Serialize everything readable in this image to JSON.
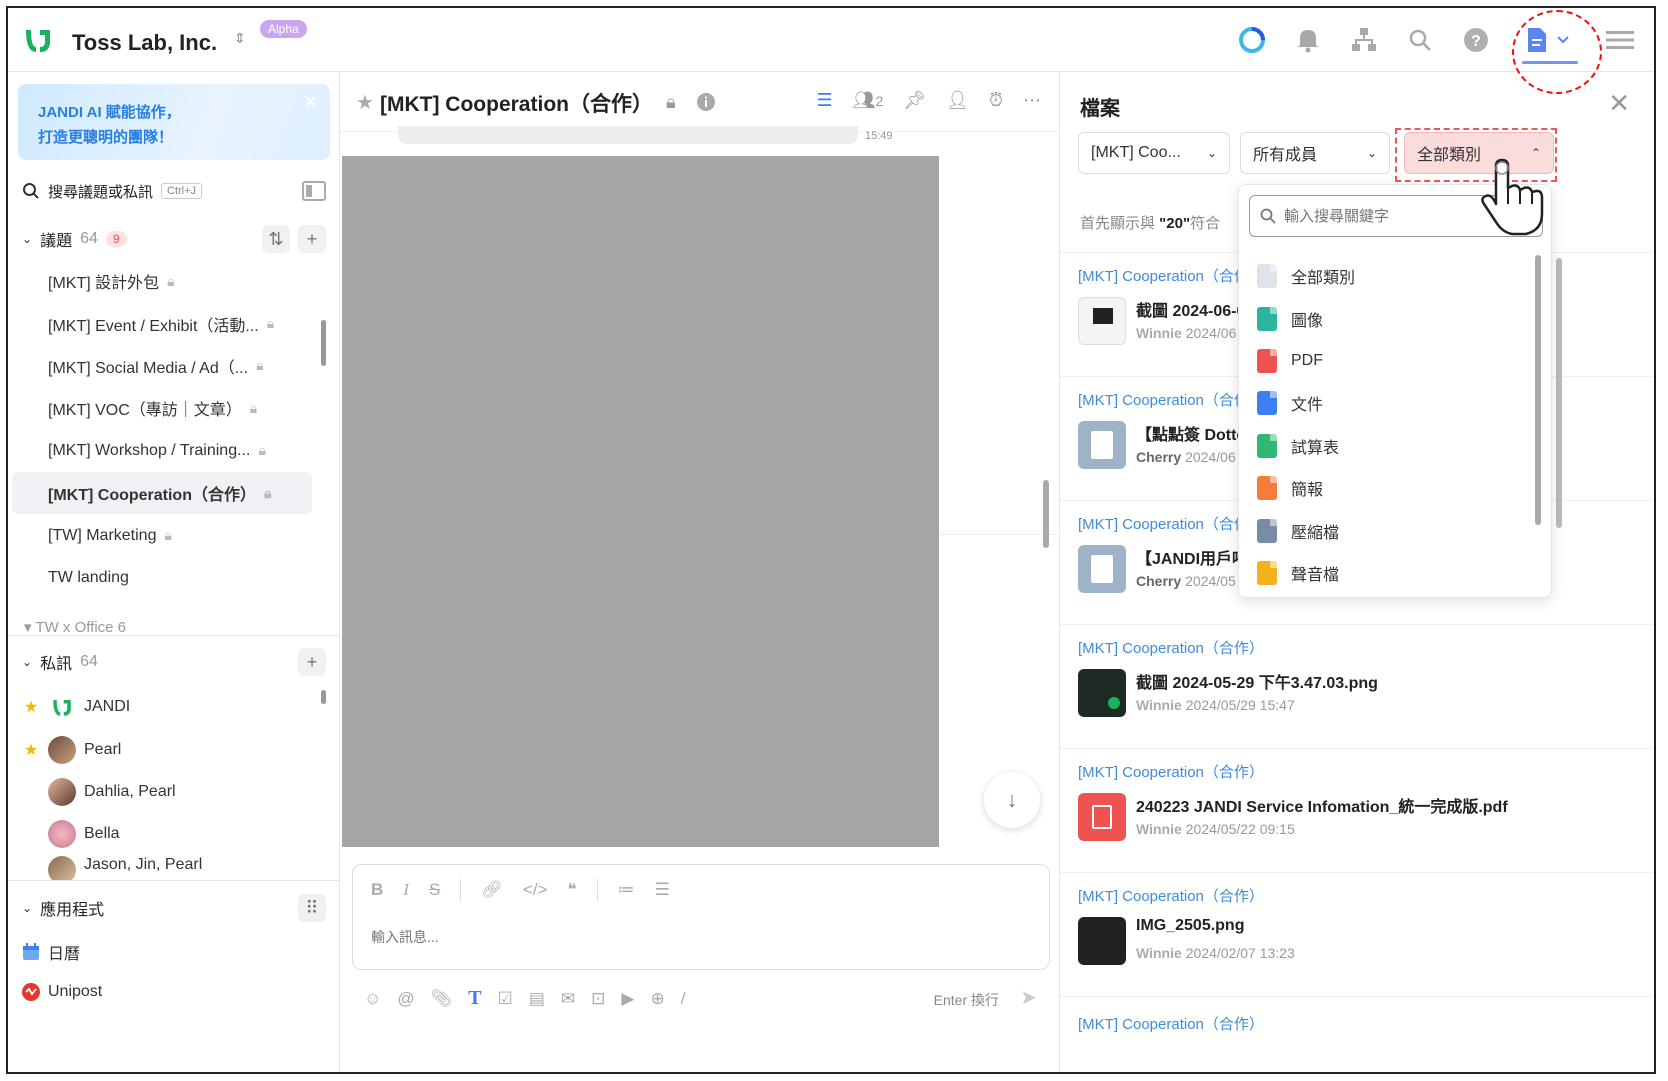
{
  "org": {
    "name": "Toss Lab, Inc.",
    "badge": "Alpha"
  },
  "top_icons": [
    "loading-ring-icon",
    "bell-icon",
    "org-chart-icon",
    "search-icon",
    "help-icon",
    "file-icon",
    "menu-icon"
  ],
  "sidebar": {
    "ai_banner": {
      "line1": "JANDI AI 賦能協作，",
      "line2": "打造更聰明的團隊！"
    },
    "search": {
      "label": "搜尋議題或私訊",
      "shortcut": "Ctrl+J"
    },
    "topics": {
      "title": "議題",
      "count": "64",
      "unread": "9",
      "items": [
        {
          "label": "[MKT] 設計外包"
        },
        {
          "label": "[MKT] Event / Exhibit（活動..."
        },
        {
          "label": "[MKT] Social Media / Ad（..."
        },
        {
          "label": "[MKT] VOC（專訪｜文章）"
        },
        {
          "label": "[MKT] Workshop / Training..."
        },
        {
          "label": "[MKT] Cooperation（合作）"
        },
        {
          "label": "[TW] Marketing"
        },
        {
          "label": "TW landing"
        }
      ],
      "folder": "TW x Office 6"
    },
    "dms": {
      "title": "私訊",
      "count": "64",
      "items": [
        {
          "label": "JANDI"
        },
        {
          "label": "Pearl"
        },
        {
          "label": "Dahlia, Pearl"
        },
        {
          "label": "Bella"
        },
        {
          "label": "Jason, Jin, Pearl"
        }
      ]
    },
    "apps": {
      "title": "應用程式",
      "items": [
        {
          "label": "日曆"
        },
        {
          "label": "Unipost"
        }
      ]
    }
  },
  "chat": {
    "title": "[MKT] Cooperation（合作）",
    "member_count": "2",
    "message_time": "15:49",
    "composer_placeholder": "輸入訊息...",
    "enter_hint": "Enter 換行"
  },
  "files": {
    "title": "檔案",
    "filters": {
      "topic": "[MKT] Coo...",
      "member": "所有成員",
      "category": "全部類別"
    },
    "result_prefix": "首先顯示與 ",
    "result_query": "\"20\"",
    "result_suffix": "符合",
    "cards": [
      {
        "topic": "[MKT] Cooperation（合作）",
        "name": "截圖 2024-06-0",
        "author": "Winnie",
        "date": "2024/06"
      },
      {
        "topic": "[MKT] Cooperation（合作）",
        "name": "【點點簽 Dotte",
        "author": "Cherry",
        "date": "2024/06"
      },
      {
        "topic": "[MKT] Cooperation（合作）",
        "name": "【JANDI用戶呼",
        "author": "Cherry",
        "date": "2024/05"
      },
      {
        "topic": "[MKT] Cooperation（合作）",
        "name": "截圖 2024-05-29 下午3.47.03.png",
        "author": "Winnie",
        "date": "2024/05/29 15:47"
      },
      {
        "topic": "[MKT] Cooperation（合作）",
        "name": "240223 JANDI Service Infomation_統一完成版.pdf",
        "author": "Winnie",
        "date": "2024/05/22 09:15"
      },
      {
        "topic": "[MKT] Cooperation（合作）",
        "name": "IMG_2505.png",
        "author": "Winnie",
        "date": "2024/02/07 13:23"
      },
      {
        "topic": "[MKT] Cooperation（合作）",
        "name": "",
        "author": "",
        "date": ""
      }
    ],
    "dropdown": {
      "placeholder": "輸入搜尋關鍵字",
      "options": [
        {
          "label": "全部類別",
          "color": "#dfe3ea"
        },
        {
          "label": "圖像",
          "color": "#2bb5a0"
        },
        {
          "label": "PDF",
          "color": "#ef5350"
        },
        {
          "label": "文件",
          "color": "#3b7ff0"
        },
        {
          "label": "試算表",
          "color": "#2eb872"
        },
        {
          "label": "簡報",
          "color": "#f57c3b"
        },
        {
          "label": "壓縮檔",
          "color": "#7a8ba8"
        },
        {
          "label": "聲音檔",
          "color": "#f6b01b"
        }
      ]
    }
  }
}
